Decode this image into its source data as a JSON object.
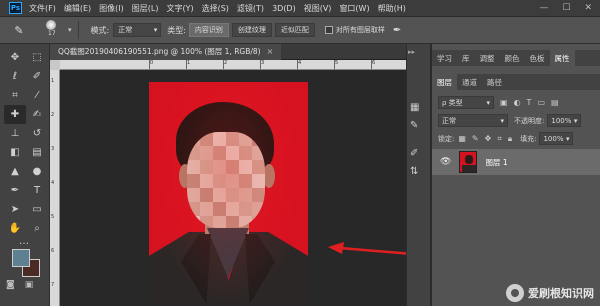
{
  "app": {
    "logo": "Ps"
  },
  "menu": [
    "文件(F)",
    "编辑(E)",
    "图像(I)",
    "图层(L)",
    "文字(Y)",
    "选择(S)",
    "滤镜(T)",
    "3D(D)",
    "视图(V)",
    "窗口(W)",
    "帮助(H)"
  ],
  "window_controls": [
    "—",
    "☐",
    "✕"
  ],
  "options": {
    "brush_size": "17",
    "mode_label": "模式:",
    "mode_value": "正常",
    "type_label": "类型:",
    "type_buttons": [
      "内容识别",
      "创建纹理",
      "近似匹配"
    ],
    "active_type": 0,
    "sample_all_label": "对所有图层取样"
  },
  "document": {
    "tab_title": "QQ截图20190406190551.png @ 100% (图层 1, RGB/8)",
    "close": "×",
    "ruler_h": [
      "0",
      "1",
      "2",
      "3",
      "4",
      "5",
      "6",
      "7",
      "8"
    ],
    "ruler_v": [
      "1",
      "2",
      "3",
      "4",
      "5",
      "6",
      "7"
    ]
  },
  "panels": {
    "top_tabs": [
      "学习",
      "库",
      "调整",
      "颜色",
      "色板",
      "属性"
    ],
    "layer_tabs": [
      "图层",
      "通道",
      "路径"
    ],
    "filter_label": "ρ 类型",
    "blend_mode": "正常",
    "opacity_label": "不透明度:",
    "opacity_value": "100%",
    "lock_label": "锁定:",
    "fill_label": "填充:",
    "fill_value": "100%",
    "layer_name": "图层 1"
  },
  "watermark": "爱刷根知识网",
  "colors": {
    "foreground": "#5f8090",
    "background": "#4a2a22",
    "photo_bg": "#d61120",
    "arrow": "#e02020"
  },
  "icons": {
    "toolbar": [
      "move-icon",
      "marquee-icon",
      "lasso-icon",
      "quick-select-icon",
      "crop-icon",
      "eyedropper-icon",
      "healing-brush-icon",
      "brush-icon",
      "stamp-icon",
      "history-brush-icon",
      "eraser-icon",
      "gradient-icon",
      "blur-icon",
      "dodge-icon",
      "pen-icon",
      "type-icon",
      "path-select-icon",
      "shape-icon",
      "hand-icon",
      "zoom-icon"
    ]
  }
}
